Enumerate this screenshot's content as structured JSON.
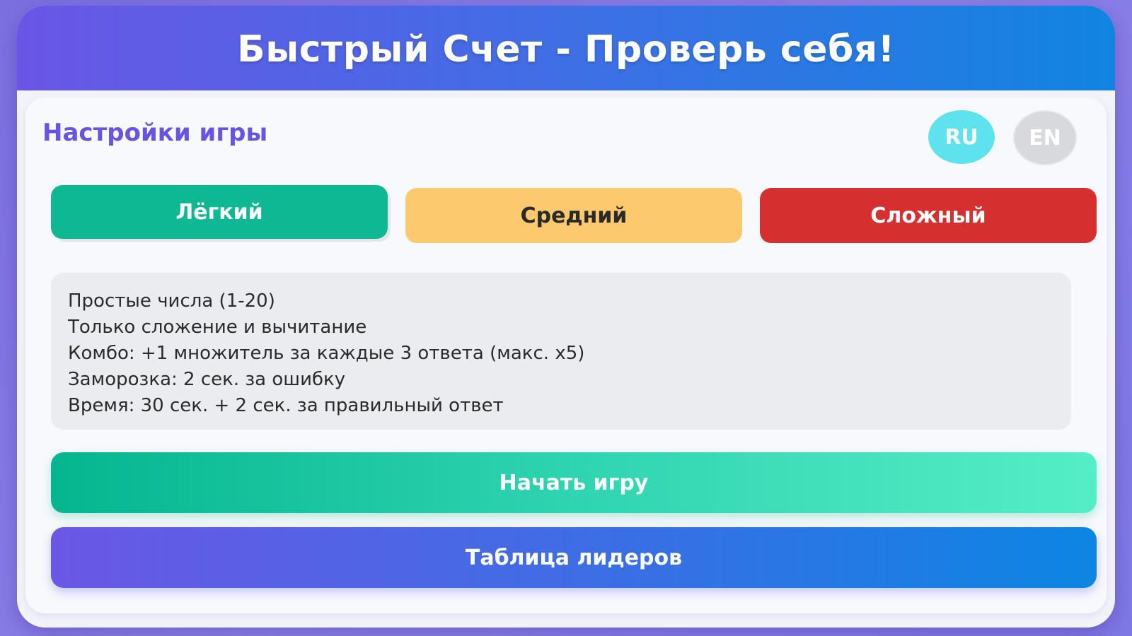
{
  "header": {
    "title": "Быстрый Счет - Проверь себя!"
  },
  "settings": {
    "title": "Настройки игры",
    "languages": [
      {
        "label": "RU",
        "active": true,
        "color": "#5de3ee"
      },
      {
        "label": "EN",
        "active": false,
        "color": "#d8d9dd"
      }
    ]
  },
  "difficulty": {
    "options": [
      {
        "label": "Лёгкий",
        "color": "#0db893",
        "selected": true
      },
      {
        "label": "Средний",
        "color": "#fdc96e",
        "selected": false
      },
      {
        "label": "Сложный",
        "color": "#d62f2f",
        "selected": false
      }
    ]
  },
  "info": {
    "lines": [
      "Простые числа (1-20)",
      "Только сложение и вычитание",
      "Комбо: +1 множитель за каждые 3 ответа (макс. x5)",
      "Заморозка: 2 сек. за ошибку",
      "Время: 30 сек. + 2 сек. за правильный ответ"
    ]
  },
  "actions": {
    "start_label": "Начать игру",
    "leaderboard_label": "Таблица лидеров"
  },
  "colors": {
    "accent": "#6a53e4",
    "header_gradient_start": "#6a56e6",
    "header_gradient_end": "#1184e2",
    "start_gradient_start": "#04b68f",
    "start_gradient_end": "#55eec6"
  }
}
